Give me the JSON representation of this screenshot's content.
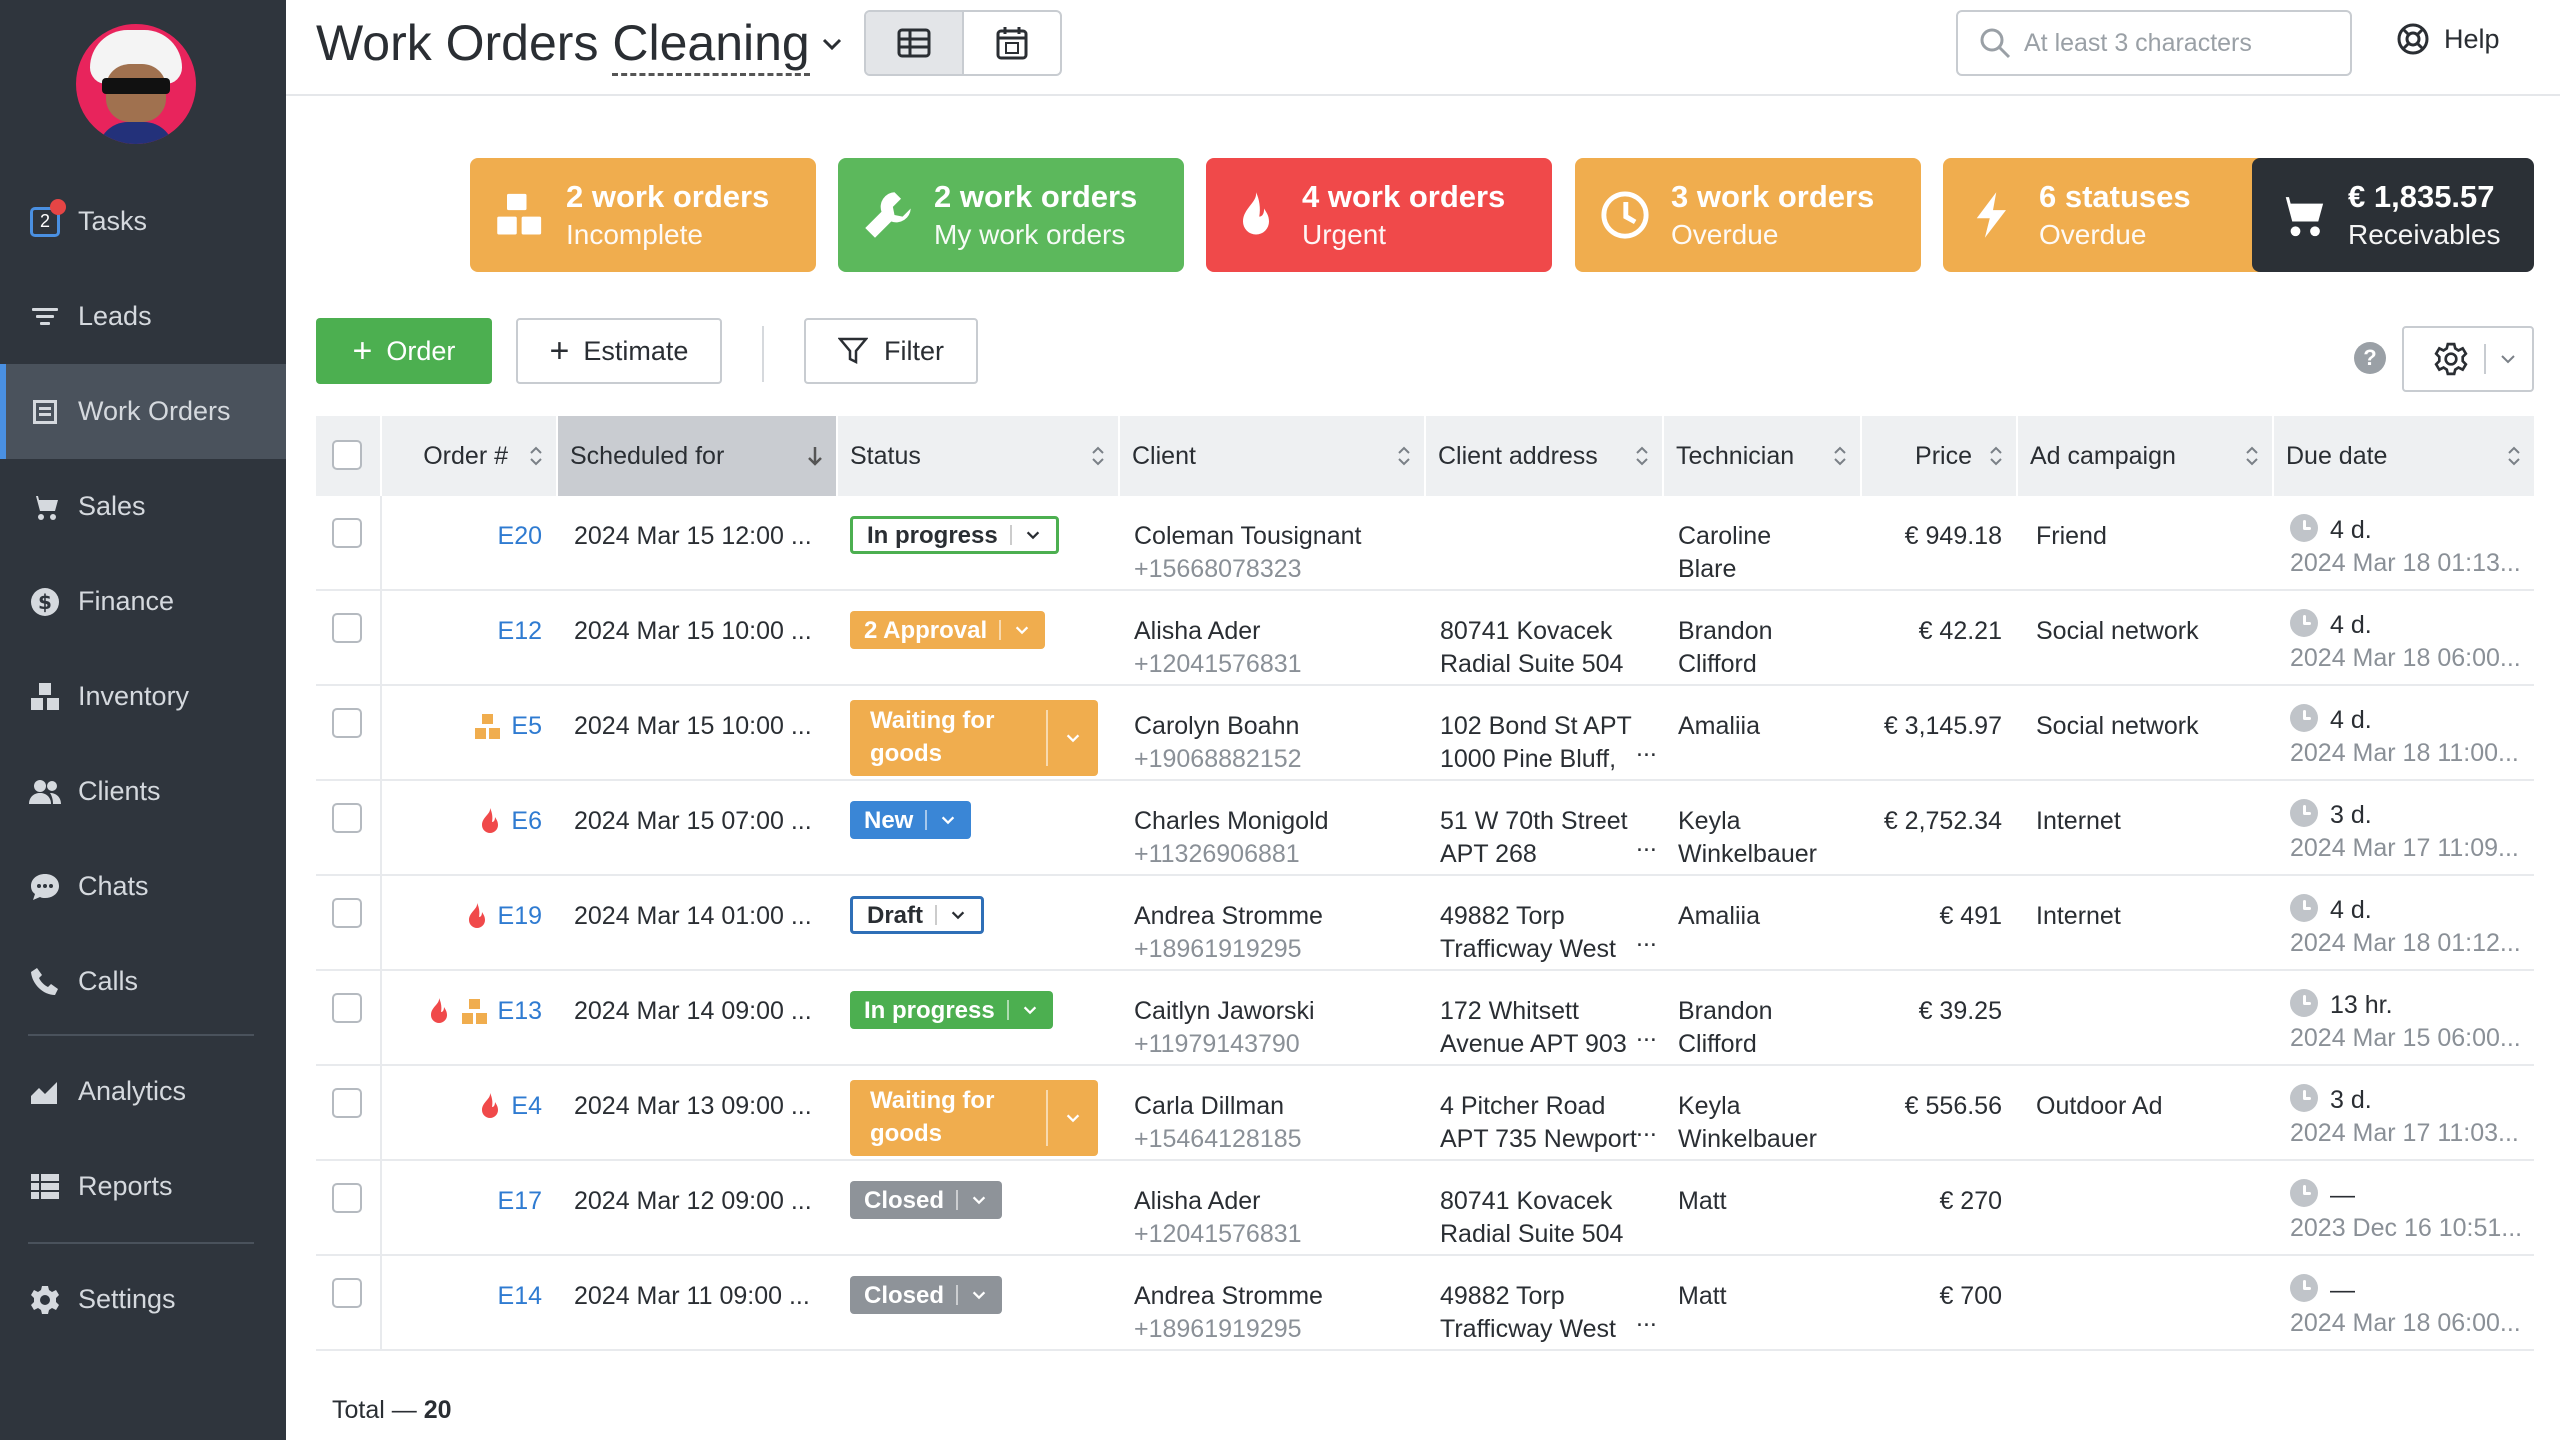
{
  "app": {
    "title_main": "Work Orders",
    "title_sub": "Cleaning"
  },
  "search": {
    "placeholder": "At least 3 characters"
  },
  "help_label": "Help",
  "sidebar": {
    "tasks_count": "2",
    "items": [
      {
        "label": "Tasks",
        "icon": "tasks-icon"
      },
      {
        "label": "Leads",
        "icon": "filter-icon"
      },
      {
        "label": "Work Orders",
        "icon": "work-orders-icon",
        "active": true
      },
      {
        "label": "Sales",
        "icon": "cart-icon"
      },
      {
        "label": "Finance",
        "icon": "dollar-icon"
      },
      {
        "label": "Inventory",
        "icon": "boxes-icon"
      },
      {
        "label": "Clients",
        "icon": "users-icon"
      },
      {
        "label": "Chats",
        "icon": "chat-icon"
      },
      {
        "label": "Calls",
        "icon": "phone-icon"
      },
      {
        "label": "Analytics",
        "icon": "chart-icon"
      },
      {
        "label": "Reports",
        "icon": "list-icon"
      },
      {
        "label": "Settings",
        "icon": "gear-icon"
      }
    ]
  },
  "cards": [
    {
      "title": "2 work orders",
      "subtitle": "Incomplete",
      "color": "#f0ad4e",
      "icon": "boxes-icon"
    },
    {
      "title": "2 work orders",
      "subtitle": "My work orders",
      "color": "#5cb85c",
      "icon": "wrench-icon"
    },
    {
      "title": "4 work orders",
      "subtitle": "Urgent",
      "color": "#f0494a",
      "icon": "flame-icon"
    },
    {
      "title": "3 work orders",
      "subtitle": "Overdue",
      "color": "#f0ad4e",
      "icon": "clock-icon"
    },
    {
      "title": "6 statuses",
      "subtitle": "Overdue",
      "color": "#f0ad4e",
      "icon": "lightning-icon"
    },
    {
      "title": "€ 1,835.57",
      "subtitle": "Receivables",
      "color": "#2b3036",
      "icon": "cart-icon"
    }
  ],
  "toolbar": {
    "order_label": "Order",
    "estimate_label": "Estimate",
    "filter_label": "Filter",
    "help_mark": "?"
  },
  "table": {
    "columns": [
      "Order #",
      "Scheduled for",
      "Status",
      "Client",
      "Client address",
      "Technician",
      "Price",
      "Ad campaign",
      "Due date"
    ],
    "rows": [
      {
        "order": "E20",
        "urgent": false,
        "incomplete": false,
        "scheduled": "2024 Mar 15 12:00 ...",
        "status": "In progress",
        "status_style": "progress-outline",
        "client": "Coleman Tousignant",
        "phone": "+15668078323",
        "addr1": "",
        "addr2": "",
        "addr_more": false,
        "tech1": "Caroline",
        "tech2": "Blare",
        "price": "€ 949.18",
        "campaign": "Friend",
        "due1": "4 d.",
        "due2": "2024 Mar 18 01:13..."
      },
      {
        "order": "E12",
        "urgent": false,
        "incomplete": false,
        "scheduled": "2024 Mar 15 10:00 ...",
        "status": "2 Approval",
        "status_style": "orange",
        "client": "Alisha Ader",
        "phone": "+12041576831",
        "addr1": "80741 Kovacek",
        "addr2": "Radial Suite 504",
        "addr_more": false,
        "tech1": "Brandon",
        "tech2": "Clifford",
        "price": "€ 42.21",
        "campaign": "Social network",
        "due1": "4 d.",
        "due2": "2024 Mar 18 06:00..."
      },
      {
        "order": "E5",
        "urgent": false,
        "incomplete": true,
        "scheduled": "2024 Mar 15 10:00 ...",
        "status": "Waiting for goods",
        "status_style": "wait",
        "client": "Carolyn Boahn",
        "phone": "+19068882152",
        "addr1": "102 Bond St APT",
        "addr2": "1000 Pine Bluff,",
        "addr_more": true,
        "tech1": "Amaliia",
        "tech2": "",
        "price": "€ 3,145.97",
        "campaign": "Social network",
        "due1": "4 d.",
        "due2": "2024 Mar 18 11:00..."
      },
      {
        "order": "E6",
        "urgent": true,
        "incomplete": false,
        "scheduled": "2024 Mar 15 07:00 ...",
        "status": "New",
        "status_style": "blue",
        "client": "Charles Monigold",
        "phone": "+11326906881",
        "addr1": "51 W 70th Street",
        "addr2": "APT 268",
        "addr_more": true,
        "tech1": "Keyla",
        "tech2": "Winkelbauer",
        "price": "€ 2,752.34",
        "campaign": "Internet",
        "due1": "3 d.",
        "due2": "2024 Mar 17 11:09..."
      },
      {
        "order": "E19",
        "urgent": true,
        "incomplete": false,
        "scheduled": "2024 Mar 14 01:00 ...",
        "status": "Draft",
        "status_style": "draft",
        "client": "Andrea Stromme",
        "phone": "+18961919295",
        "addr1": "49882 Torp",
        "addr2": "Trafficway West",
        "addr_more": true,
        "tech1": "Amaliia",
        "tech2": "",
        "price": "€ 491",
        "campaign": "Internet",
        "due1": "4 d.",
        "due2": "2024 Mar 18 01:12..."
      },
      {
        "order": "E13",
        "urgent": true,
        "incomplete": true,
        "scheduled": "2024 Mar 14 09:00 ...",
        "status": "In progress",
        "status_style": "green",
        "client": "Caitlyn Jaworski",
        "phone": "+11979143790",
        "addr1": "172 Whitsett",
        "addr2": "Avenue APT 903",
        "addr_more": true,
        "tech1": "Brandon",
        "tech2": "Clifford",
        "price": "€ 39.25",
        "campaign": "",
        "due1": "13 hr.",
        "due2": "2024 Mar 15 06:00..."
      },
      {
        "order": "E4",
        "urgent": true,
        "incomplete": false,
        "scheduled": "2024 Mar 13 09:00 ...",
        "status": "Waiting for goods",
        "status_style": "wait",
        "client": "Carla Dillman",
        "phone": "+15464128185",
        "addr1": "4 Pitcher Road",
        "addr2": "APT 735 Newport",
        "addr_more": true,
        "tech1": "Keyla",
        "tech2": "Winkelbauer",
        "price": "€ 556.56",
        "campaign": "Outdoor Ad",
        "due1": "3 d.",
        "due2": "2024 Mar 17 11:03..."
      },
      {
        "order": "E17",
        "urgent": false,
        "incomplete": false,
        "scheduled": "2024 Mar 12 09:00 ...",
        "status": "Closed",
        "status_style": "grey",
        "client": "Alisha Ader",
        "phone": "+12041576831",
        "addr1": "80741 Kovacek",
        "addr2": "Radial Suite 504",
        "addr_more": false,
        "tech1": "Matt",
        "tech2": "",
        "price": "€ 270",
        "campaign": "",
        "due1": "—",
        "due2": "2023 Dec 16 10:51..."
      },
      {
        "order": "E14",
        "urgent": false,
        "incomplete": false,
        "scheduled": "2024 Mar 11 09:00 ...",
        "status": "Closed",
        "status_style": "grey",
        "client": "Andrea Stromme",
        "phone": "+18961919295",
        "addr1": "49882 Torp",
        "addr2": "Trafficway West",
        "addr_more": true,
        "tech1": "Matt",
        "tech2": "",
        "price": "€ 700",
        "campaign": "",
        "due1": "—",
        "due2": "2024 Mar 18 06:00..."
      }
    ],
    "total_label": "Total —",
    "total_value": "20"
  }
}
